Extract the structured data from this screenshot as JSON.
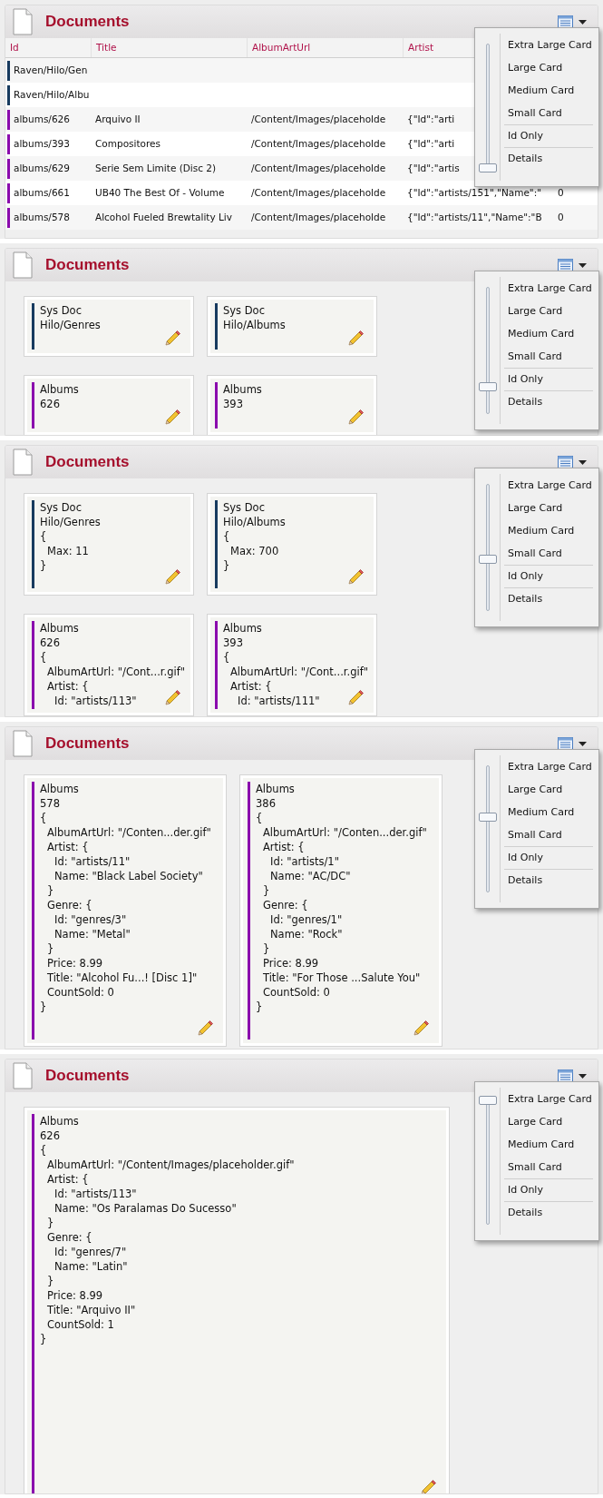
{
  "panels": [
    {
      "title": "Documents",
      "kind": "details",
      "slider": {
        "level": 0
      },
      "menu": [
        {
          "label": "Extra Large Card",
          "divider_above": false
        },
        {
          "label": "Large Card",
          "divider_above": false
        },
        {
          "label": "Medium Card",
          "divider_above": false
        },
        {
          "label": "Small Card",
          "divider_above": false
        },
        {
          "label": "Id Only",
          "divider_above": true
        },
        {
          "label": "Details",
          "divider_above": true
        }
      ],
      "table": {
        "columns": [
          "Id",
          "Title",
          "AlbumArtUrl",
          "Artist"
        ],
        "rows": [
          {
            "color": "#173a5e",
            "cells": [
              "Raven/Hilo/Gen",
              "",
              "",
              "",
              ""
            ]
          },
          {
            "color": "#173a5e",
            "cells": [
              "Raven/Hilo/Albu",
              "",
              "",
              "",
              ""
            ]
          },
          {
            "color": "#8a0aad",
            "cells": [
              "albums/626",
              "Arquivo II",
              "/Content/Images/placeholde",
              "{\"Id\":\"arti",
              ""
            ]
          },
          {
            "color": "#8a0aad",
            "cells": [
              "albums/393",
              "Compositores",
              "/Content/Images/placeholde",
              "{\"Id\":\"arti",
              ""
            ]
          },
          {
            "color": "#8a0aad",
            "cells": [
              "albums/629",
              "Serie Sem Limite (Disc 2)",
              "/Content/Images/placeholde",
              "{\"Id\":\"artis",
              ""
            ]
          },
          {
            "color": "#8a0aad",
            "cells": [
              "albums/661",
              "UB40 The Best Of - Volume",
              "/Content/Images/placeholde",
              "{\"Id\":\"artists/151\",\"Name\":\"",
              "0"
            ]
          },
          {
            "color": "#8a0aad",
            "cells": [
              "albums/578",
              "Alcohol Fueled Brewtality Liv",
              "/Content/Images/placeholde",
              "{\"Id\":\"artists/11\",\"Name\":\"B",
              "0"
            ]
          }
        ]
      }
    },
    {
      "title": "Documents",
      "kind": "id_only",
      "slider": {
        "level": 0.2
      },
      "menu": [
        {
          "label": "Extra Large Card",
          "divider_above": false
        },
        {
          "label": "Large Card",
          "divider_above": false
        },
        {
          "label": "Medium Card",
          "divider_above": false
        },
        {
          "label": "Small Card",
          "divider_above": false
        },
        {
          "label": "Id Only",
          "divider_above": true
        },
        {
          "label": "Details",
          "divider_above": true
        }
      ],
      "cards": [
        {
          "collection": "Sys Doc",
          "id": "Hilo/Genres",
          "color": "#173a5e"
        },
        {
          "collection": "Sys Doc",
          "id": "Hilo/Albums",
          "color": "#173a5e"
        },
        {
          "collection": "Albums",
          "id": "626",
          "color": "#8a0aad"
        },
        {
          "collection": "Albums",
          "id": "393",
          "color": "#8a0aad"
        }
      ]
    },
    {
      "title": "Documents",
      "kind": "small",
      "slider": {
        "level": 0.4
      },
      "menu": [
        {
          "label": "Extra Large Card",
          "divider_above": false
        },
        {
          "label": "Large Card",
          "divider_above": false
        },
        {
          "label": "Medium Card",
          "divider_above": false
        },
        {
          "label": "Small Card",
          "divider_above": false
        },
        {
          "label": "Id Only",
          "divider_above": true
        },
        {
          "label": "Details",
          "divider_above": true
        }
      ],
      "cards": [
        {
          "collection": "Sys Doc",
          "id": "Hilo/Genres",
          "color": "#173a5e",
          "body": [
            {
              "text": "{",
              "children": [
                {
                  "text": "Max: 11"
                }
              ]
            },
            {
              "text": "}"
            }
          ]
        },
        {
          "collection": "Sys Doc",
          "id": "Hilo/Albums",
          "color": "#173a5e",
          "body": [
            {
              "text": "{",
              "children": [
                {
                  "text": "Max: 700"
                }
              ]
            },
            {
              "text": "}"
            }
          ]
        },
        {
          "collection": "Albums",
          "id": "626",
          "color": "#8a0aad",
          "body": [
            {
              "text": "{",
              "children": [
                {
                  "text": "AlbumArtUrl: \"/Cont...r.gif\""
                },
                {
                  "text": "Artist: {",
                  "children": [
                    {
                      "text": "Id: \"artists/113\""
                    }
                  ]
                }
              ]
            }
          ]
        },
        {
          "collection": "Albums",
          "id": "393",
          "color": "#8a0aad",
          "body": [
            {
              "text": "{",
              "children": [
                {
                  "text": "AlbumArtUrl: \"/Cont...r.gif\""
                },
                {
                  "text": "Artist: {",
                  "children": [
                    {
                      "text": "Id: \"artists/111\""
                    }
                  ]
                }
              ]
            }
          ]
        }
      ]
    },
    {
      "title": "Documents",
      "kind": "medium",
      "slider": {
        "level": 0.6
      },
      "menu": [
        {
          "label": "Extra Large Card",
          "divider_above": false
        },
        {
          "label": "Large Card",
          "divider_above": false
        },
        {
          "label": "Medium Card",
          "divider_above": false
        },
        {
          "label": "Small Card",
          "divider_above": false
        },
        {
          "label": "Id Only",
          "divider_above": true
        },
        {
          "label": "Details",
          "divider_above": true
        }
      ],
      "cards": [
        {
          "collection": "Albums",
          "id": "578",
          "color": "#8a0aad",
          "body": [
            {
              "text": "{",
              "children": [
                {
                  "text": "AlbumArtUrl: \"/Conten...der.gif\""
                },
                {
                  "text": "Artist: {",
                  "children": [
                    {
                      "text": "Id: \"artists/11\""
                    },
                    {
                      "text": "Name: \"Black Label Society\""
                    }
                  ]
                },
                {
                  "text": "}"
                },
                {
                  "text": "Genre: {",
                  "children": [
                    {
                      "text": "Id: \"genres/3\""
                    },
                    {
                      "text": "Name: \"Metal\""
                    }
                  ]
                },
                {
                  "text": "}"
                },
                {
                  "text": "Price: 8.99"
                },
                {
                  "text": "Title: \"Alcohol Fu...! [Disc 1]\""
                },
                {
                  "text": "CountSold: 0"
                }
              ]
            },
            {
              "text": "}"
            }
          ]
        },
        {
          "collection": "Albums",
          "id": "386",
          "color": "#8a0aad",
          "body": [
            {
              "text": "{",
              "children": [
                {
                  "text": "AlbumArtUrl: \"/Conten...der.gif\""
                },
                {
                  "text": "Artist: {",
                  "children": [
                    {
                      "text": "Id: \"artists/1\""
                    },
                    {
                      "text": "Name: \"AC/DC\""
                    }
                  ]
                },
                {
                  "text": "}"
                },
                {
                  "text": "Genre: {",
                  "children": [
                    {
                      "text": "Id: \"genres/1\""
                    },
                    {
                      "text": "Name: \"Rock\""
                    }
                  ]
                },
                {
                  "text": "}"
                },
                {
                  "text": "Price: 8.99"
                },
                {
                  "text": "Title: \"For Those ...Salute You\""
                },
                {
                  "text": "CountSold: 0"
                }
              ]
            },
            {
              "text": "}"
            }
          ]
        }
      ]
    },
    {
      "title": "Documents",
      "kind": "extra_large",
      "slider": {
        "level": 1
      },
      "menu": [
        {
          "label": "Extra Large Card",
          "divider_above": false
        },
        {
          "label": "Large Card",
          "divider_above": false
        },
        {
          "label": "Medium Card",
          "divider_above": false
        },
        {
          "label": "Small Card",
          "divider_above": false
        },
        {
          "label": "Id Only",
          "divider_above": true
        },
        {
          "label": "Details",
          "divider_above": true
        }
      ],
      "cards": [
        {
          "collection": "Albums",
          "id": "626",
          "color": "#8a0aad",
          "body": [
            {
              "text": "{",
              "children": [
                {
                  "text": "AlbumArtUrl: \"/Content/Images/placeholder.gif\""
                },
                {
                  "text": "Artist: {",
                  "children": [
                    {
                      "text": "Id: \"artists/113\""
                    },
                    {
                      "text": "Name: \"Os Paralamas Do Sucesso\""
                    }
                  ]
                },
                {
                  "text": "}"
                },
                {
                  "text": "Genre: {",
                  "children": [
                    {
                      "text": "Id: \"genres/7\""
                    },
                    {
                      "text": "Name: \"Latin\""
                    }
                  ]
                },
                {
                  "text": "}"
                },
                {
                  "text": "Price: 8.99"
                },
                {
                  "text": "Title: \"Arquivo II\""
                },
                {
                  "text": "CountSold: 1"
                }
              ]
            },
            {
              "text": "}"
            }
          ]
        }
      ]
    }
  ]
}
